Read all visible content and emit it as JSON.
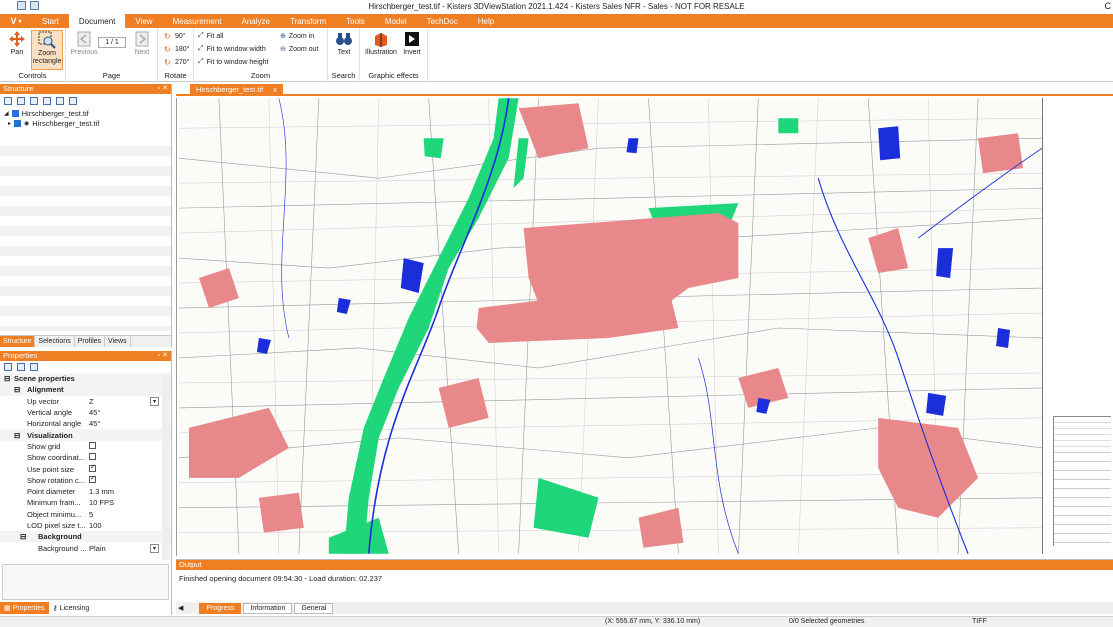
{
  "window": {
    "title": "Hirschberger_test.tif - Kisters 3DViewStation 2021.1.424 - Kisters Sales NFR - Sales - NOT FOR RESALE",
    "close_glyph": "C"
  },
  "menu": {
    "app_label": "V",
    "tabs": [
      "Start",
      "Document",
      "View",
      "Measurement",
      "Analyze",
      "Transform",
      "Tools",
      "Model",
      "TechDoc",
      "Help"
    ],
    "active_index": 1
  },
  "ribbon": {
    "controls": {
      "pan": "Pan",
      "zoom_rectangle_1": "Zoom",
      "zoom_rectangle_2": "rectangle",
      "label": "Controls"
    },
    "page": {
      "previous": "Previous",
      "next": "Next",
      "page_value": "1 / 1",
      "label": "Page"
    },
    "rotate": {
      "r90": "90°",
      "r180": "180°",
      "r270": "270°",
      "label": "Rotate"
    },
    "zoom": {
      "fit_all": "Fit all",
      "fit_width": "Fit to window width",
      "fit_height": "Fit to window height",
      "zoom_in": "Zoom in",
      "zoom_out": "Zoom out",
      "label": "Zoom"
    },
    "search": {
      "text": "Text",
      "label": "Search"
    },
    "graphic": {
      "illustration": "Illustration",
      "invert": "Invert",
      "label": "Graphic effects"
    }
  },
  "structure": {
    "title": "Structure",
    "items": [
      "Hirschberger_test.tif",
      "Hirschberger_test.tif"
    ],
    "tabs": [
      "Structure",
      "Selections",
      "Profiles",
      "Views"
    ]
  },
  "properties": {
    "title": "Properties",
    "rows": [
      {
        "name": "Scene properties",
        "value": ""
      },
      {
        "name": "Alignment",
        "value": ""
      },
      {
        "name": "Up vector",
        "value": "Z"
      },
      {
        "name": "Vertical angle",
        "value": "45°"
      },
      {
        "name": "Horizontal angle",
        "value": "45°"
      },
      {
        "name": "Visualization",
        "value": ""
      },
      {
        "name": "Show grid",
        "value": ""
      },
      {
        "name": "Show coordinat...",
        "value": ""
      },
      {
        "name": "Use point size",
        "value": ""
      },
      {
        "name": "Show rotation c...",
        "value": ""
      },
      {
        "name": "Point diameter",
        "value": "1.3 mm"
      },
      {
        "name": "Minimum fram...",
        "value": "10 FPS"
      },
      {
        "name": "Object minimu...",
        "value": "5"
      },
      {
        "name": "LOD pixel size t...",
        "value": "100"
      },
      {
        "name": "Background",
        "value": ""
      },
      {
        "name": "Background ...",
        "value": "Plain"
      }
    ]
  },
  "left_bottom_tabs": [
    "Properties",
    "Licensing"
  ],
  "document": {
    "tab": "Hirschberger_test.tif",
    "tab_close": "x"
  },
  "output": {
    "title": "Output",
    "message": "Finished opening document 09:54:30 - Load duration: 02.237",
    "tabs": [
      "Progress",
      "Information",
      "General"
    ]
  },
  "status": {
    "coords": "(X: 555.67 mm, Y: 336.10 mm)",
    "selection": "0/0 Selected geometries",
    "format": "TIFF"
  },
  "colors": {
    "accent": "#f07f23",
    "urban": "#e8888a",
    "forest": "#1fd67a",
    "water": "#1a2fd9"
  }
}
